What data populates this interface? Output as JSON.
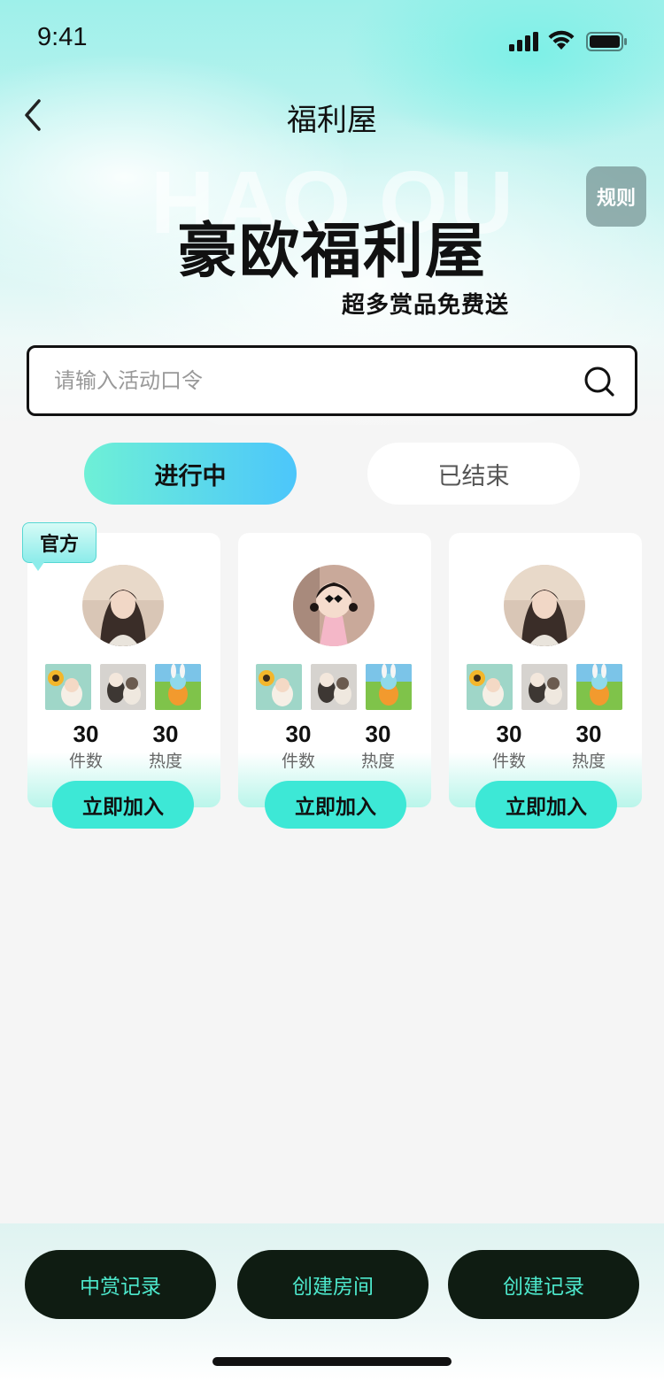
{
  "status_bar": {
    "time": "9:41"
  },
  "nav": {
    "title": "福利屋"
  },
  "hero": {
    "watermark": "HAO OU",
    "title": "豪欧福利屋",
    "subtitle": "超多赏品免费送",
    "rules_label": "规则"
  },
  "search": {
    "placeholder": "请输入活动口令",
    "value": ""
  },
  "tabs": [
    {
      "label": "进行中",
      "active": true
    },
    {
      "label": "已结束",
      "active": false
    }
  ],
  "cards": [
    {
      "badge": "官方",
      "avatar": "girl-photo",
      "prizes": [
        "sunflower-figure",
        "black-white-figure",
        "bunny-figure"
      ],
      "count_value": "30",
      "count_label": "件数",
      "heat_value": "30",
      "heat_label": "热度",
      "join_label": "立即加入"
    },
    {
      "avatar": "cartoon-girl",
      "prizes": [
        "sunflower-figure",
        "black-white-figure",
        "bunny-figure"
      ],
      "count_value": "30",
      "count_label": "件数",
      "heat_value": "30",
      "heat_label": "热度",
      "join_label": "立即加入"
    },
    {
      "avatar": "girl-photo",
      "prizes": [
        "sunflower-figure",
        "black-white-figure",
        "bunny-figure"
      ],
      "count_value": "30",
      "count_label": "件数",
      "heat_value": "30",
      "heat_label": "热度",
      "join_label": "立即加入"
    }
  ],
  "bottom_buttons": [
    {
      "label": "中赏记录"
    },
    {
      "label": "创建房间"
    },
    {
      "label": "创建记录"
    }
  ],
  "colors": {
    "accent": "#3de8d6",
    "tab_gradient_start": "#6ef0d6",
    "tab_gradient_end": "#4cc6fb",
    "bottom_button_bg": "#0f1c12",
    "bottom_button_text": "#4de8cc"
  }
}
